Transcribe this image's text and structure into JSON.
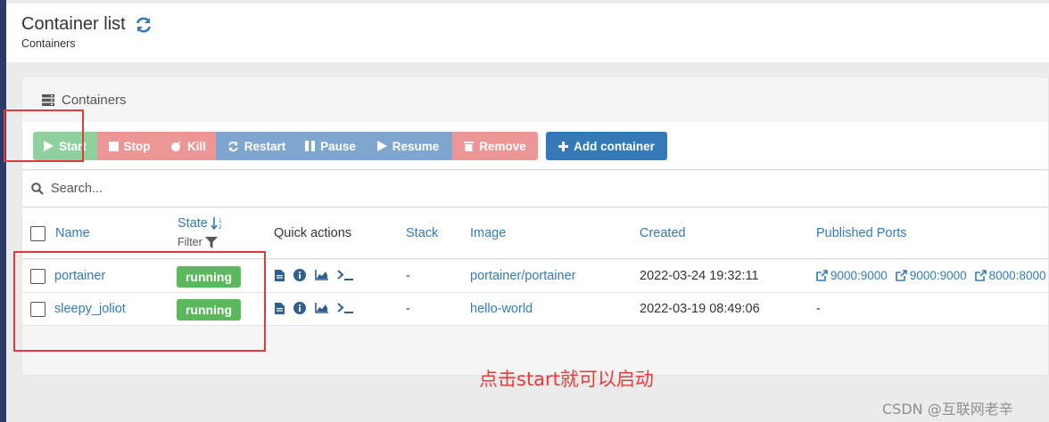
{
  "header": {
    "title": "Container list",
    "breadcrumb": "Containers"
  },
  "widget": {
    "title": "Containers"
  },
  "toolbar": {
    "start": "Start",
    "stop": "Stop",
    "kill": "Kill",
    "restart": "Restart",
    "pause": "Pause",
    "resume": "Resume",
    "remove": "Remove",
    "add": "Add container"
  },
  "search": {
    "placeholder": "Search..."
  },
  "table": {
    "headers": {
      "name": "Name",
      "state": "State",
      "filter": "Filter",
      "quick_actions": "Quick actions",
      "stack": "Stack",
      "image": "Image",
      "created": "Created",
      "ports": "Published Ports"
    },
    "rows": [
      {
        "name": "portainer",
        "state": "running",
        "stack": "-",
        "image": "portainer/portainer",
        "created": "2022-03-24 19:32:11",
        "ports": [
          "9000:9000",
          "9000:9000",
          "8000:8000"
        ]
      },
      {
        "name": "sleepy_joliot",
        "state": "running",
        "stack": "-",
        "image": "hello-world",
        "created": "2022-03-19 08:49:06",
        "ports_text": "-"
      }
    ]
  },
  "annotation": "点击start就可以启动",
  "watermark": "CSDN @互联网老辛",
  "colors": {
    "primary": "#337ab7",
    "success": "#5cb85c",
    "start_button": "#8fd19e",
    "danger_button": "#ec9696",
    "info_button": "#7fa6cf",
    "annotation_red": "#e63b3b",
    "sidebar": "#2b3a67"
  },
  "icons": {
    "refresh": "refresh-icon",
    "widget": "server-icon",
    "search": "search-icon",
    "sort": "sort-alpha-icon",
    "filter": "filter-icon",
    "logs": "file-icon",
    "inspect": "info-icon",
    "stats": "chart-icon",
    "console": "terminal-icon",
    "external_link": "external-link-icon"
  }
}
